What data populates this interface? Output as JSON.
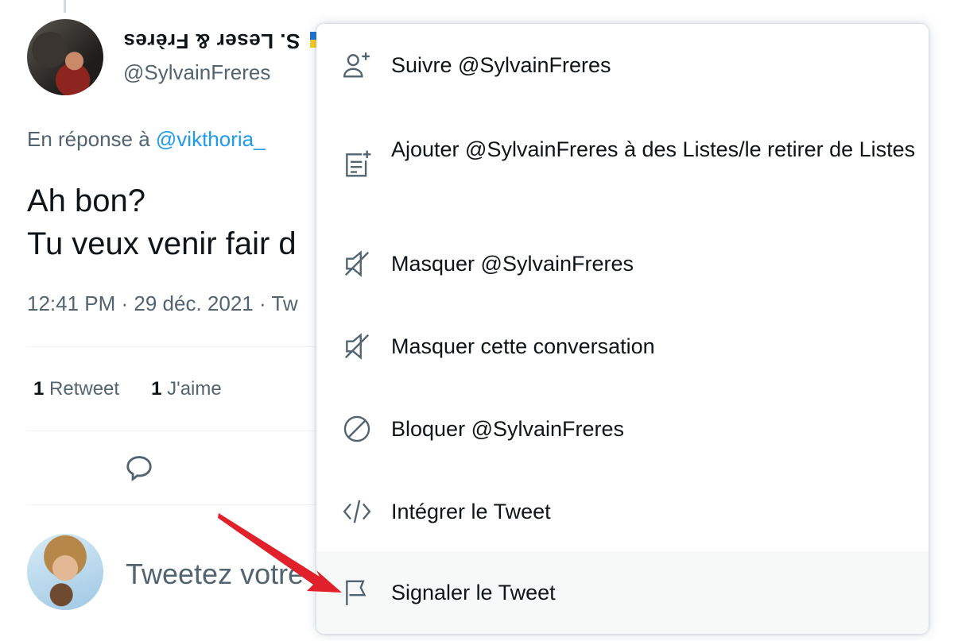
{
  "tweet": {
    "display_name": "S. Leser & Frères",
    "handle": "@SylvainFreres",
    "reply_prefix": "En réponse à",
    "reply_mention": "@vikthoria_",
    "text_line1": "Ah bon?",
    "text_line2": "Tu veux venir fair d",
    "timestamp": "12:41 PM · 29 déc. 2021 · Tw",
    "retweet_count": "1",
    "retweet_label": "Retweet",
    "like_count": "1",
    "like_label": "J'aime"
  },
  "compose": {
    "placeholder": "Tweetez votre"
  },
  "menu": {
    "items": [
      {
        "label": "Suivre @SylvainFreres",
        "icon": "follow-user-icon"
      },
      {
        "label": "Ajouter @SylvainFreres à des Listes/le retirer de Listes",
        "icon": "add-to-list-icon"
      },
      {
        "label": "Masquer @SylvainFreres",
        "icon": "mute-icon"
      },
      {
        "label": "Masquer cette conversation",
        "icon": "mute-icon"
      },
      {
        "label": "Bloquer @SylvainFreres",
        "icon": "block-icon"
      },
      {
        "label": "Intégrer le Tweet",
        "icon": "embed-code-icon"
      },
      {
        "label": "Signaler le Tweet",
        "icon": "report-flag-icon"
      }
    ]
  },
  "colors": {
    "accent": "#1d9bf0",
    "secondary_text": "#536471",
    "primary_text": "#0f1419",
    "annotation_arrow": "#e0202a"
  }
}
